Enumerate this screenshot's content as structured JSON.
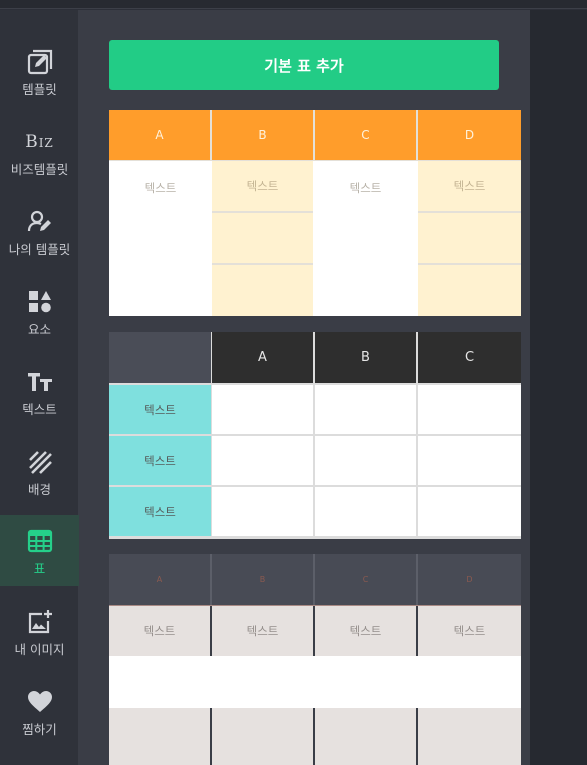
{
  "sidebar": {
    "items": [
      {
        "label": "템플릿",
        "icon": "template-edit-icon",
        "active": false
      },
      {
        "label": "비즈템플릿",
        "icon": "biz-icon",
        "icon_text": "Biz",
        "active": false
      },
      {
        "label": "나의 템플릿",
        "icon": "user-edit-icon",
        "active": false
      },
      {
        "label": "요소",
        "icon": "shapes-icon",
        "active": false
      },
      {
        "label": "텍스트",
        "icon": "text-icon",
        "icon_text": "TT",
        "active": false
      },
      {
        "label": "배경",
        "icon": "background-stripes-icon",
        "active": false
      },
      {
        "label": "표",
        "icon": "table-icon",
        "active": true
      },
      {
        "label": "내 이미지",
        "icon": "add-image-icon",
        "active": false
      },
      {
        "label": "찜하기",
        "icon": "heart-icon",
        "active": false
      }
    ]
  },
  "panel": {
    "add_button_label": "기본 표 추가",
    "tables": [
      {
        "style": "orange-header",
        "header": [
          "A",
          "B",
          "C",
          "D"
        ],
        "rows": [
          [
            "텍스트",
            "텍스트",
            "텍스트",
            "텍스트"
          ],
          [
            "",
            "",
            "",
            ""
          ],
          [
            "",
            "",
            "",
            ""
          ]
        ]
      },
      {
        "style": "dark-header-cyan-side",
        "header": [
          "",
          "A",
          "B",
          "C"
        ],
        "row_labels": [
          "텍스트",
          "텍스트",
          "텍스트"
        ]
      },
      {
        "style": "grey-striped",
        "header": [
          "A",
          "B",
          "C",
          "D"
        ],
        "rows": [
          [
            "텍스트",
            "텍스트",
            "텍스트",
            "텍스트"
          ],
          [
            "",
            "",
            "",
            ""
          ],
          [
            "",
            "",
            "",
            ""
          ]
        ]
      }
    ]
  },
  "colors": {
    "accent": "#22cc86",
    "orange": "#ff9d2b",
    "cream": "#fff2d0",
    "cyan": "#7fe0de",
    "dark": "#2e2e2e",
    "panel": "#3a3d46"
  }
}
